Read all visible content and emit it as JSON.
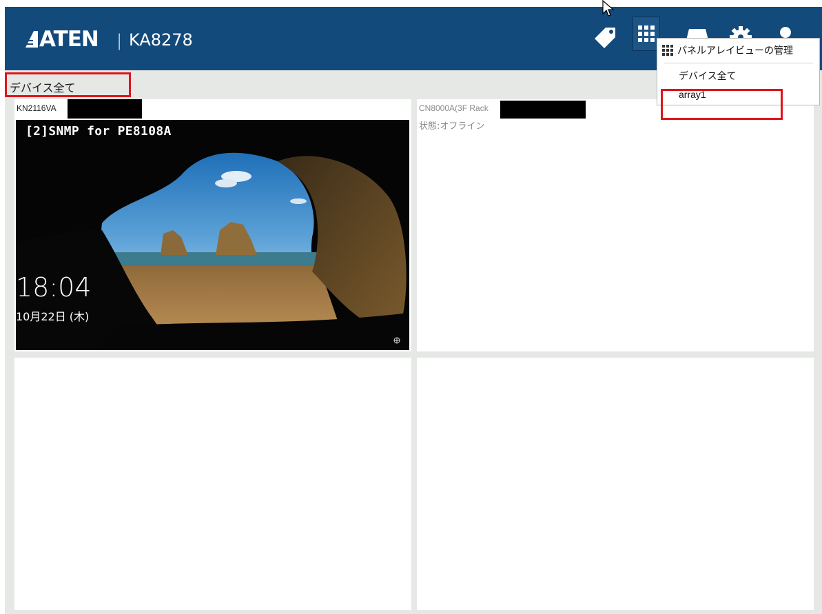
{
  "header": {
    "logo_text": "ATEN",
    "separator": "|",
    "model": "KA8278",
    "icons": [
      "tag-icon",
      "panel-array-icon",
      "monitor-icon",
      "gear-icon",
      "user-icon"
    ],
    "brand_color": "#134a7c"
  },
  "breadcrumb": {
    "label": "デバイス全て"
  },
  "dropdown": {
    "header_label": "パネルアレイビューの管理",
    "items": [
      {
        "label": "デバイス全て"
      },
      {
        "label": "array1"
      }
    ]
  },
  "panels": [
    {
      "device_label": "KN2116VA",
      "screen_title": "[2]SNMP for PE8108A",
      "clock": "18:04",
      "date": "10月22日 (木)"
    },
    {
      "device_label": "CN8000A(3F Rack",
      "status": "状態:オフライン"
    },
    {},
    {}
  ],
  "highlight_color": "#e0141c"
}
